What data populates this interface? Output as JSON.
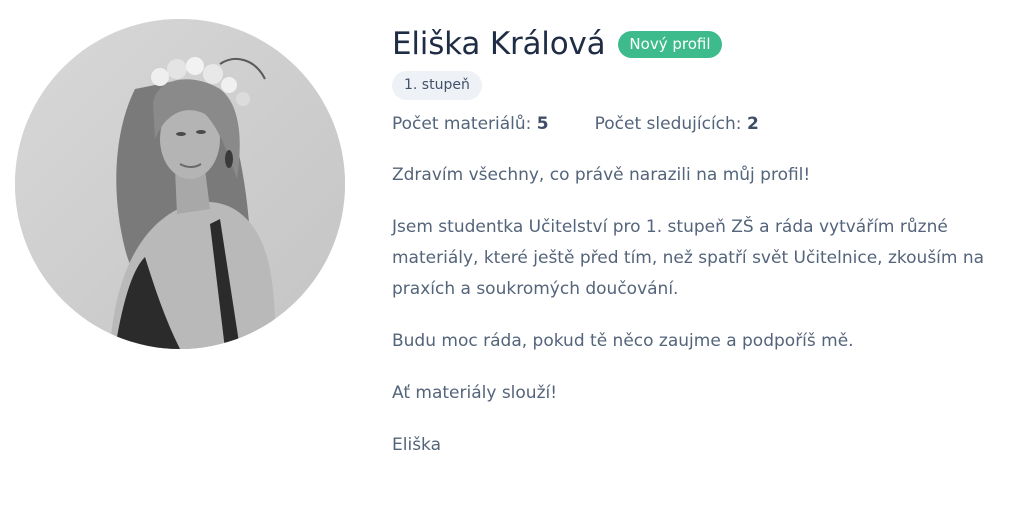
{
  "profile": {
    "name": "Eliška Králová",
    "badge": "Nový profil",
    "grade": "1. stupeň",
    "stats": {
      "materials_label": "Počet materiálů:",
      "materials_count": "5",
      "followers_label": "Počet sledujících:",
      "followers_count": "2"
    },
    "bio": [
      "Zdravím všechny, co právě narazili na můj profil!",
      "Jsem studentka Učitelství pro 1. stupeň ZŠ a ráda vytvářím různé materiály, které ještě před tím, než spatří svět Učitelnice, zkouším na praxích a soukromých doučování.",
      "Budu moc ráda, pokud tě něco zaujme a podpoříš mě.",
      "Ať materiály slouží!",
      "Eliška"
    ]
  },
  "colors": {
    "badge": "#3dbb8c",
    "heading": "#1e2c44",
    "text": "#54647a",
    "tag_bg": "#eef1f5"
  }
}
